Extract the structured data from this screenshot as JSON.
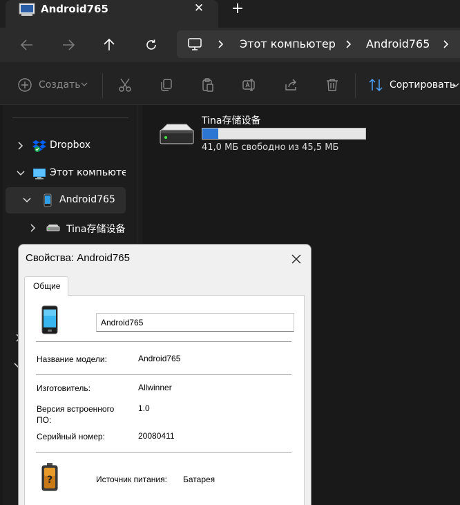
{
  "window": {
    "tab_title": "Android765",
    "tab_close": "✕",
    "new_tab": "+"
  },
  "address": {
    "crumbs": [
      "Этот компьютер",
      "Android765"
    ]
  },
  "toolbar": {
    "create_label": "Создать",
    "sort_label": "Сортировать"
  },
  "sidebar": {
    "items": [
      {
        "label": "Dropbox",
        "icon": "dropbox-icon",
        "expanded": false
      },
      {
        "label": "Этот компьютер",
        "icon": "computer-icon",
        "expanded": true
      },
      {
        "label": "Android765",
        "icon": "phone-icon",
        "expanded": true,
        "selected": true
      },
      {
        "label": "Tina存储设备",
        "icon": "drive-icon",
        "expanded": false
      }
    ]
  },
  "content": {
    "drive_name": "Tina存储设备",
    "drive_free_text": "41,0 МБ свободно из 45,5 МБ",
    "used_fraction": 0.099
  },
  "dialog": {
    "title": "Свойства: Android765",
    "tab_label": "Общие",
    "device_name": "Android765",
    "model_label": "Название модели:",
    "model_value": "Android765",
    "manufacturer_label": "Изготовитель:",
    "manufacturer_value": "Allwinner",
    "firmware_label": "Версия встроенного ПО:",
    "firmware_value": "1.0",
    "serial_label": "Серийный номер:",
    "serial_value": "20080411",
    "power_label": "Источник питания:",
    "power_value": "Батарея"
  },
  "colors": {
    "accent": "#2b76d2",
    "dark_bg": "#191919",
    "dialog_bg": "#f0f0f0"
  }
}
